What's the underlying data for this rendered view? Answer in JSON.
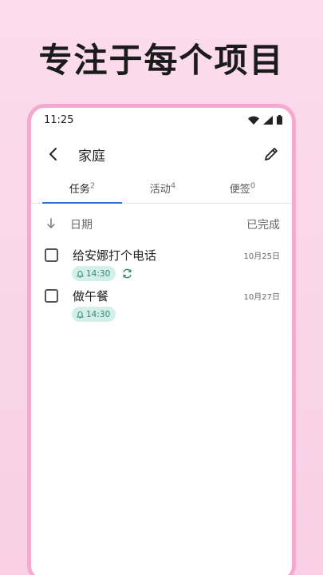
{
  "promo": {
    "headline": "专注于每个项目"
  },
  "status_bar": {
    "time": "11:25"
  },
  "app_bar": {
    "title": "家庭"
  },
  "tabs": [
    {
      "label": "任务",
      "count": "2",
      "active": true
    },
    {
      "label": "活动",
      "count": "4",
      "active": false
    },
    {
      "label": "便签",
      "count": "0",
      "active": false
    }
  ],
  "sort": {
    "label": "日期",
    "completed_label": "已完成"
  },
  "tasks": [
    {
      "title": "给安娜打个电话",
      "reminder": "14:30",
      "repeat": true,
      "date": "10月25日"
    },
    {
      "title": "做午餐",
      "reminder": "14:30",
      "repeat": false,
      "date": "10月27日"
    }
  ],
  "colors": {
    "accent": "#2f6fd6",
    "chip_bg": "#d3efe8",
    "chip_text": "#2d8a72",
    "frame": "#f6a9cf"
  }
}
